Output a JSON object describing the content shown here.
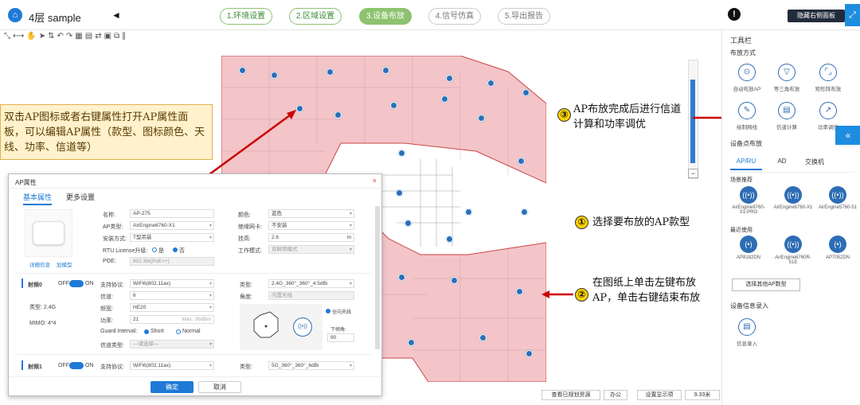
{
  "header": {
    "logo": "home-logo",
    "floor_label": "4层 sample",
    "prev_caret": "◄",
    "steps": [
      {
        "label": "1.环境设置",
        "state": "done"
      },
      {
        "label": "2.区域设置",
        "state": "done"
      },
      {
        "label": "3.设备布放",
        "state": "active"
      },
      {
        "label": "4.信号仿真",
        "state": "todo"
      },
      {
        "label": "5.导出报告",
        "state": "todo"
      }
    ],
    "alert": "!",
    "hide_panel": "隐藏右侧面板",
    "expand_icon": "⤢"
  },
  "toolbar_glyphs": "⤡⟷✋➤⇅↶↷▦▤⇄▣⧉∥",
  "callouts": {
    "c1": "双击AP图标或者右键属性打开AP属性面板，可以编辑AP属性（款型、图标颜色、天线、功率、信道等）",
    "c3_num": "③",
    "c3": "AP布放完成后进行信道计算和功率调优",
    "c1n": "①",
    "c1n_text": "选择要布放的AP款型",
    "c2_num": "②",
    "c2": "在图纸上单击左键布放AP，单击右键结束布放"
  },
  "dialog": {
    "title": "AP属性",
    "close": "×",
    "tabs": [
      "基本属性",
      "更多设置"
    ],
    "links": [
      "详细信息",
      "加模型"
    ],
    "fields_left": [
      {
        "label": "名称:",
        "value": "AP-275"
      },
      {
        "label": "AP类型:",
        "value": "AirEngine6760-X1"
      },
      {
        "label": "安装方式:",
        "value": "T型吊装"
      },
      {
        "label": "RTU License升级:",
        "opt_a": "是",
        "opt_b": "否"
      },
      {
        "label": "POE:",
        "value": "802.3bt(PoE++)"
      }
    ],
    "fields_right": [
      {
        "label": "颜色:",
        "value": "蓝色"
      },
      {
        "label": "绝缘网卡:",
        "value": "不安装"
      },
      {
        "label": "挂高:",
        "value": "2.6",
        "unit": "m"
      },
      {
        "label": "工作模式:",
        "value": "双射频模式"
      }
    ],
    "radio0": {
      "name": "射频0",
      "off": "OFF",
      "on": "ON",
      "type": "类型: 2.4G",
      "mimo": "MIMO: 4*4",
      "fields": [
        {
          "label": "支持协议:",
          "value": "WiFi6(802.11ax)"
        },
        {
          "label": "信道:",
          "value": "6"
        },
        {
          "label": "频宽:",
          "value": "HE20"
        },
        {
          "label": "功率:",
          "value": "21",
          "hint": "Max: 26dBm"
        }
      ],
      "gi_label": "Guard Interval:",
      "gi_a": "Short",
      "gi_b": "Normal",
      "ch_type": "信道类型:",
      "ch_type_val": "—请选择—",
      "ant_label": "类型:",
      "ant_value": "2.4G_360°_360°_4.5dBi",
      "angle_label": "角度:",
      "angle_value": "内置天线",
      "omni": "全向天线",
      "down_label": "下倾角:",
      "down_value": "90"
    },
    "radio1": {
      "name": "射频1",
      "off": "OFF",
      "on": "ON",
      "proto_label": "支持协议:",
      "proto_value": "WiFi6(802.11ax)",
      "ant_label": "类型:",
      "ant_value": "5G_360°_360°_6dBi"
    },
    "ok": "确定",
    "cancel": "取消"
  },
  "panel": {
    "title": "工具栏",
    "deploy_mode": "布放方式",
    "tools": [
      {
        "label": "自动布放AP",
        "icon": "⊙"
      },
      {
        "label": "等三角布放",
        "icon": "▽"
      },
      {
        "label": "矩形阵布放",
        "icon": "⌜⌟"
      },
      {
        "label": "绘制网线",
        "icon": "✎"
      },
      {
        "label": "信道计算",
        "icon": "▤"
      },
      {
        "label": "功率调优",
        "icon": "↗"
      }
    ],
    "device_deploy": "设备点布放",
    "dtabs": [
      "AP/RU",
      "AD",
      "交换机"
    ],
    "recommend": "场景推荐",
    "rec_aps": [
      {
        "label": "AirEngine8760-X1-PRO",
        "icon": "((•))"
      },
      {
        "label": "AirEngine6760-X1",
        "icon": "((•))"
      },
      {
        "label": "AirEngine5760-51",
        "icon": "((•))"
      }
    ],
    "recent": "最近使用",
    "recent_aps": [
      {
        "label": "AP8182DN",
        "icon": "(•)"
      },
      {
        "label": "AirEngine6760R-51E",
        "icon": "((•))"
      },
      {
        "label": "AP7052DN",
        "icon": "(•)"
      }
    ],
    "choose_other": "选择其他AP数型",
    "info_entry": "设备信息录入",
    "info_btn": "信息录入",
    "collapse": "«"
  },
  "bottom": {
    "b1": "查看已规划资源",
    "b2": "办公",
    "b3": "设置显示项",
    "zoom": "9.33米"
  }
}
